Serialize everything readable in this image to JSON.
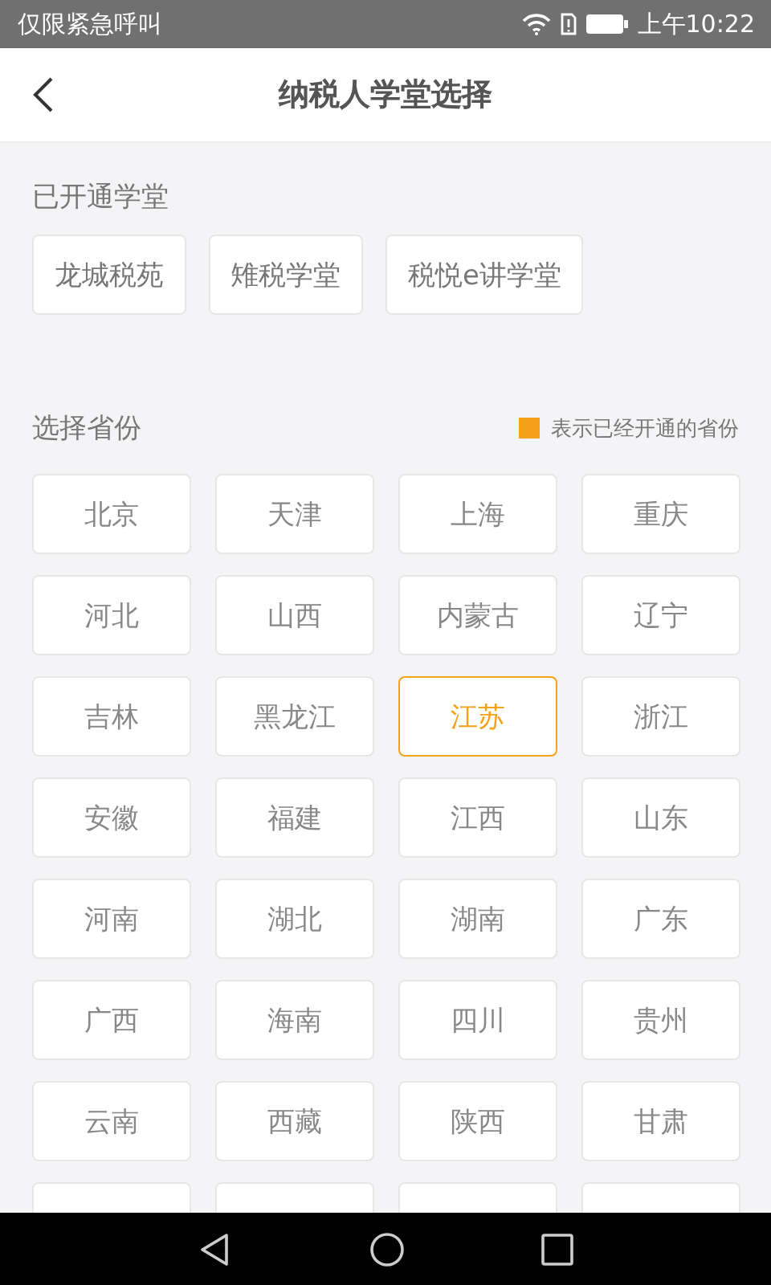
{
  "status_bar": {
    "carrier": "仅限紧急呼叫",
    "time": "上午10:22"
  },
  "header": {
    "title": "纳税人学堂选择"
  },
  "opened": {
    "heading": "已开通学堂",
    "items": [
      "龙城税苑",
      "雉税学堂",
      "税悦e讲学堂"
    ]
  },
  "provinces": {
    "heading": "选择省份",
    "legend": "表示已经开通的省份",
    "items": [
      {
        "label": "北京",
        "selected": false
      },
      {
        "label": "天津",
        "selected": false
      },
      {
        "label": "上海",
        "selected": false
      },
      {
        "label": "重庆",
        "selected": false
      },
      {
        "label": "河北",
        "selected": false
      },
      {
        "label": "山西",
        "selected": false
      },
      {
        "label": "内蒙古",
        "selected": false
      },
      {
        "label": "辽宁",
        "selected": false
      },
      {
        "label": "吉林",
        "selected": false
      },
      {
        "label": "黑龙江",
        "selected": false
      },
      {
        "label": "江苏",
        "selected": true
      },
      {
        "label": "浙江",
        "selected": false
      },
      {
        "label": "安徽",
        "selected": false
      },
      {
        "label": "福建",
        "selected": false
      },
      {
        "label": "江西",
        "selected": false
      },
      {
        "label": "山东",
        "selected": false
      },
      {
        "label": "河南",
        "selected": false
      },
      {
        "label": "湖北",
        "selected": false
      },
      {
        "label": "湖南",
        "selected": false
      },
      {
        "label": "广东",
        "selected": false
      },
      {
        "label": "广西",
        "selected": false
      },
      {
        "label": "海南",
        "selected": false
      },
      {
        "label": "四川",
        "selected": false
      },
      {
        "label": "贵州",
        "selected": false
      },
      {
        "label": "云南",
        "selected": false
      },
      {
        "label": "西藏",
        "selected": false
      },
      {
        "label": "陕西",
        "selected": false
      },
      {
        "label": "甘肃",
        "selected": false
      }
    ]
  }
}
